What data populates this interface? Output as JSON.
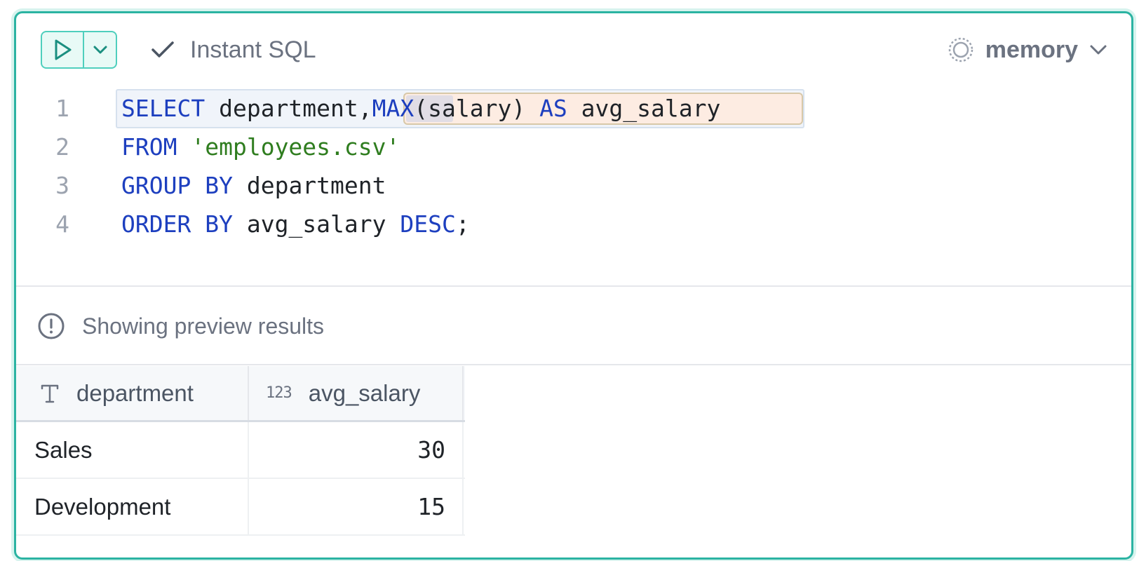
{
  "toolbar": {
    "run_icon": "play-icon",
    "dropdown_icon": "chevron-down-icon",
    "instant_icon": "check-icon",
    "instant_label": "Instant SQL",
    "db_icon": "database-status-icon",
    "db_label": "memory",
    "db_dropdown_icon": "chevron-down-icon"
  },
  "editor": {
    "line_numbers": [
      "1",
      "2",
      "3",
      "4"
    ],
    "lines": [
      {
        "tokens": [
          {
            "text": "SELECT",
            "type": "keyword"
          },
          {
            "text": " department,",
            "type": "plain"
          },
          {
            "text": "MAX",
            "type": "keyword"
          },
          {
            "text": "(salary) ",
            "type": "plain"
          },
          {
            "text": "AS",
            "type": "keyword"
          },
          {
            "text": " avg_salary",
            "type": "plain"
          }
        ]
      },
      {
        "tokens": [
          {
            "text": "FROM",
            "type": "keyword"
          },
          {
            "text": " ",
            "type": "plain"
          },
          {
            "text": "'employees.csv'",
            "type": "string"
          }
        ]
      },
      {
        "tokens": [
          {
            "text": "GROUP",
            "type": "keyword"
          },
          {
            "text": " ",
            "type": "plain"
          },
          {
            "text": "BY",
            "type": "keyword"
          },
          {
            "text": " department",
            "type": "plain"
          }
        ]
      },
      {
        "tokens": [
          {
            "text": "ORDER",
            "type": "keyword"
          },
          {
            "text": " ",
            "type": "plain"
          },
          {
            "text": "BY",
            "type": "keyword"
          },
          {
            "text": " avg_salary ",
            "type": "plain"
          },
          {
            "text": "DESC",
            "type": "keyword"
          },
          {
            "text": ";",
            "type": "plain"
          }
        ]
      }
    ]
  },
  "notice": {
    "icon": "info-icon",
    "text": "Showing preview results"
  },
  "results": {
    "columns": [
      {
        "type_icon": "T",
        "name": "department"
      },
      {
        "type_icon": "123",
        "name": "avg_salary"
      }
    ],
    "rows": [
      [
        "Sales",
        "30"
      ],
      [
        "Development",
        "15"
      ]
    ]
  },
  "colors": {
    "accent": "#2bb3a2",
    "keyword": "#1d3fbf",
    "string": "#2f7d1f",
    "muted": "#6b7280"
  }
}
